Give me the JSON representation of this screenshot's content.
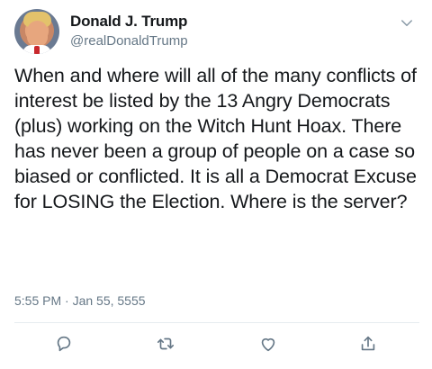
{
  "tweet": {
    "author_name": "Donald J. Trump",
    "author_handle": "@realDonaldTrump",
    "text": "When and where will all of the many conflicts of interest be listed by the 13 Angry Democrats (plus) working on the Witch Hunt Hoax. There has never been a group of people on a case so biased or conflicted. It is all a Democrat Excuse for LOSING the Election. Where is the server?",
    "timestamp": "5:55 PM · Jan 55, 5555"
  },
  "actions": {
    "reply_icon": "reply-icon",
    "retweet_icon": "retweet-icon",
    "like_icon": "heart-icon",
    "share_icon": "share-icon"
  },
  "colors": {
    "text_primary": "#14171a",
    "text_secondary": "#657786",
    "divider": "#e6ecf0"
  }
}
